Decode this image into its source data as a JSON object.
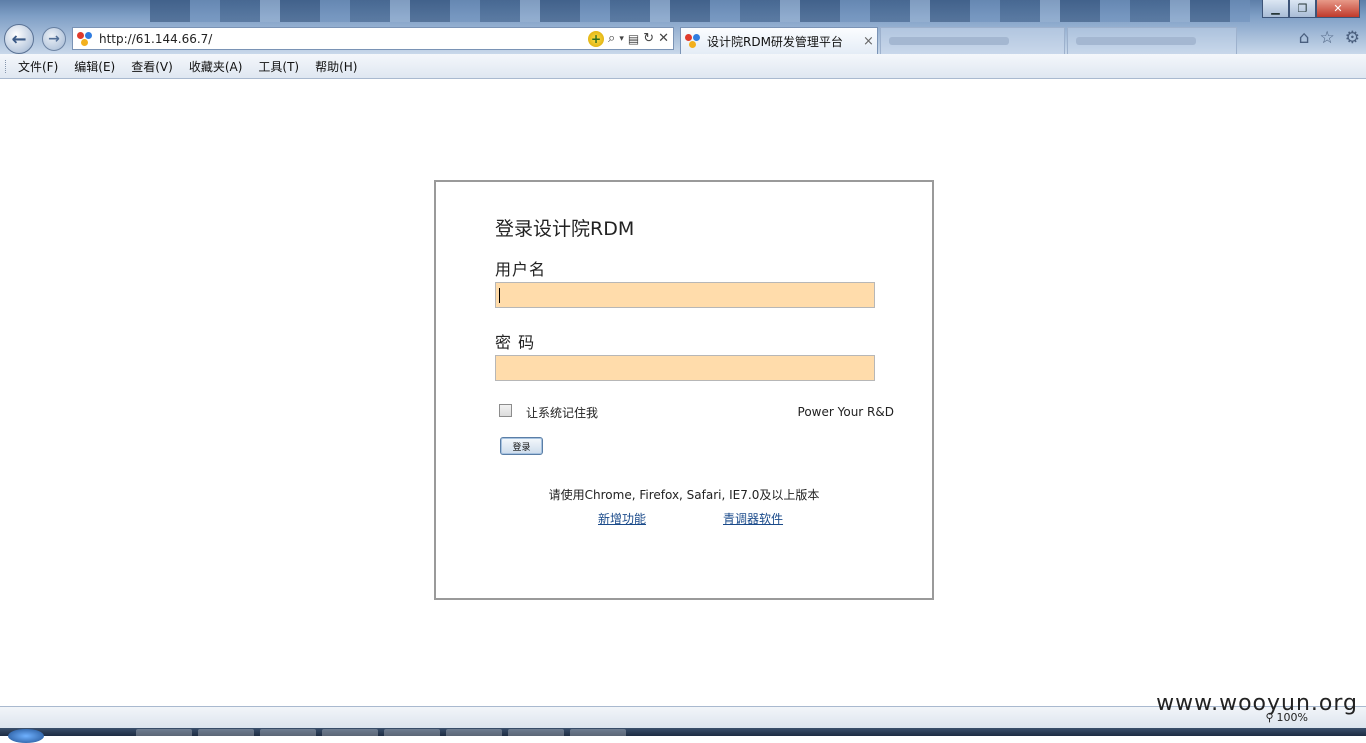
{
  "browser": {
    "address": {
      "url": "http://61.144.66.7/"
    },
    "active_tab": {
      "title": "设计院RDM研发管理平台",
      "close": "×"
    },
    "window_buttons": {
      "minimize": "▁",
      "restore": "❐",
      "close": "✕"
    },
    "menu": [
      "文件(F)",
      "编辑(E)",
      "查看(V)",
      "收藏夹(A)",
      "工具(T)",
      "帮助(H)"
    ]
  },
  "login": {
    "title": "登录设计院RDM",
    "username_label": "用户名",
    "username_value": "",
    "password_label": "密 码",
    "password_value": "",
    "remember_label": "让系统记住我",
    "slogan": "Power Your R&D",
    "submit_label": "登录",
    "browser_note": "请使用Chrome, Firefox, Safari, IE7.0及以上版本",
    "links": [
      "新增功能",
      "青调器软件"
    ]
  },
  "status": {
    "zoom": "100%"
  },
  "watermark": "www.wooyun.org"
}
